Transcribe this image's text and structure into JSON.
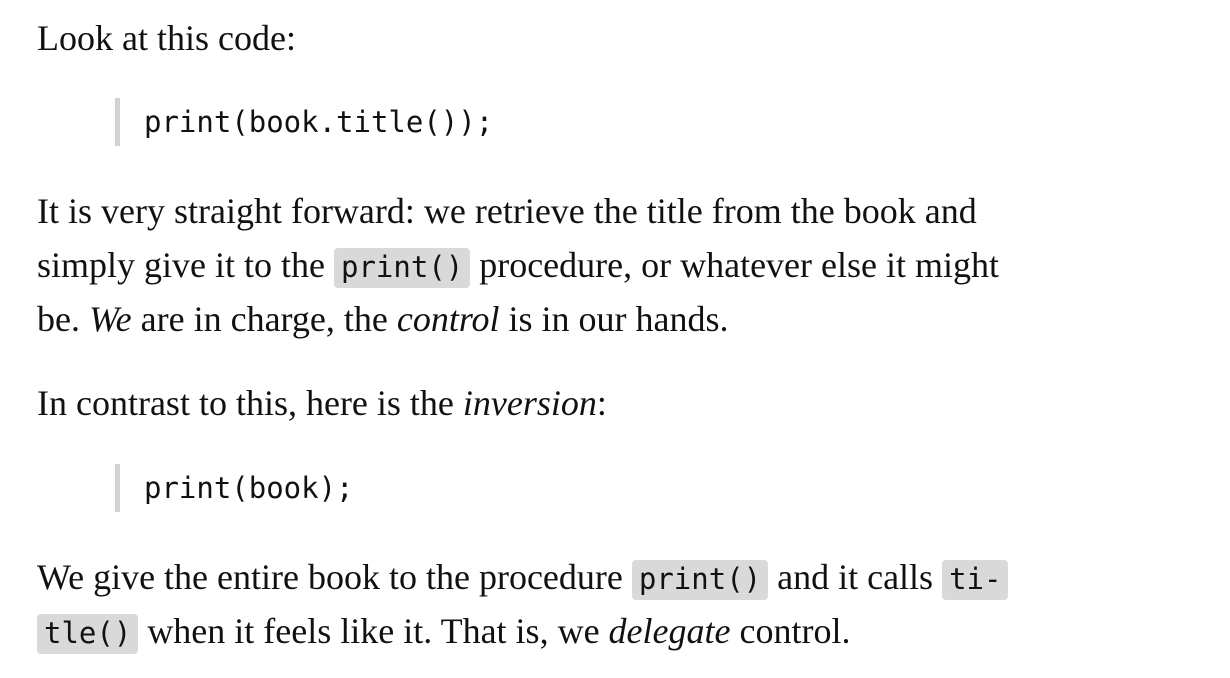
{
  "intro": "Look at this code:",
  "code1": "print(book.title());",
  "para1": {
    "line1": "It is very straight forward: we retrieve the title from the book and",
    "line2_before": "simply give it to the ",
    "line2_code": "print()",
    "line2_after": " procedure, or whatever else it might",
    "line3_a": "be. ",
    "line3_em1": "We",
    "line3_b": " are in charge, the ",
    "line3_em2": "control",
    "line3_c": " is in our hands."
  },
  "para2": {
    "before": "In contrast to this, here is the ",
    "em": "inversion",
    "after": ":"
  },
  "code2": "print(book);",
  "para3": {
    "line1_before": "We give the entire book to the procedure ",
    "line1_code1": "print()",
    "line1_mid": " and it calls ",
    "line1_code2": "ti-",
    "line2_code2": "tle()",
    "line2_a": " when it feels like it. That is, we ",
    "line2_em": "delegate",
    "line2_b": " control."
  }
}
